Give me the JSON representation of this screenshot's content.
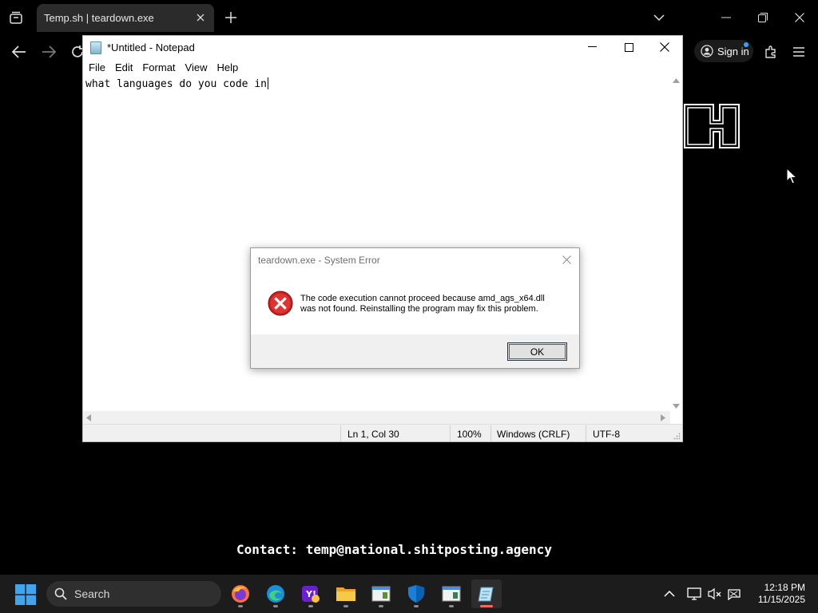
{
  "browser": {
    "tab_title": "Temp.sh | teardown.exe",
    "signin_label": "Sign in"
  },
  "page": {
    "contact": "Contact: temp@national.shitposting.agency"
  },
  "notepad": {
    "title": "*Untitled - Notepad",
    "menu": [
      "File",
      "Edit",
      "Format",
      "View",
      "Help"
    ],
    "content": "what languages do you code in",
    "status": {
      "position": "Ln 1, Col 30",
      "zoom": "100%",
      "line_ending": "Windows (CRLF)",
      "encoding": "UTF-8"
    }
  },
  "dialog": {
    "title": "teardown.exe - System Error",
    "message_line1": "The code execution cannot proceed because amd_ags_x64.dll",
    "message_line2": "was not found. Reinstalling the program may fix this problem.",
    "ok_label": "OK",
    "icon": "error-icon"
  },
  "taskbar": {
    "search_label": "Search",
    "apps": [
      "firefox-icon",
      "edge-icon",
      "yahoo-icon",
      "file-explorer-icon",
      "app-icon",
      "windows-security-icon",
      "app-icon-2",
      "notepad-icon"
    ],
    "time": "12:18 PM",
    "date": "11/15/2025"
  },
  "colors": {
    "background": "#000000",
    "taskbar": "#1c1c1c",
    "error_red": "#d42020",
    "accent_blue": "#0078d7",
    "active_indicator": "#ff6a4d"
  }
}
